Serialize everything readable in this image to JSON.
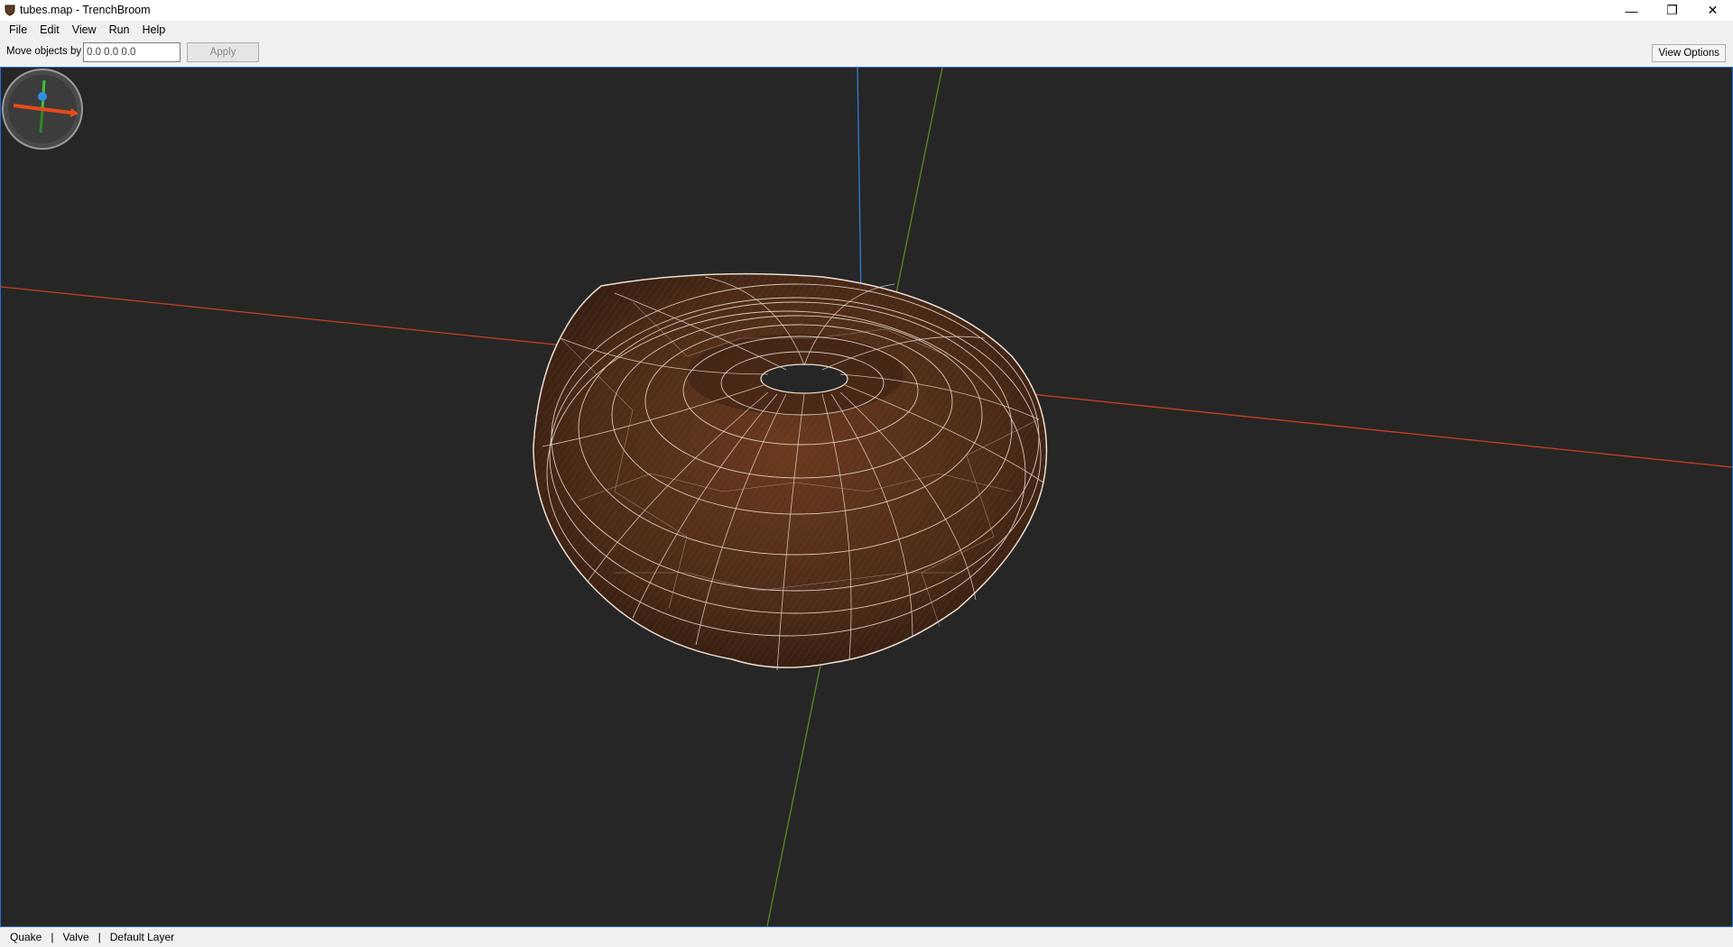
{
  "window": {
    "title": "tubes.map - TrenchBroom",
    "controls": {
      "minimize": "—",
      "restore": "❐",
      "close": "✕"
    }
  },
  "menu": {
    "items": [
      {
        "label": "File"
      },
      {
        "label": "Edit"
      },
      {
        "label": "View"
      },
      {
        "label": "Run"
      },
      {
        "label": "Help"
      }
    ]
  },
  "toolbar": {
    "move_label": "Move objects by",
    "move_value": "0.0 0.0 0.0",
    "apply_label": "Apply",
    "view_options_label": "View Options"
  },
  "viewport": {
    "background": "#262626",
    "border_color": "#2c6bd6",
    "axis_colors": {
      "x": "#c8401c",
      "y": "#5b8a1e",
      "z": "#2f7fd0"
    },
    "object": "torus brush wireframe",
    "object_fill": "#4a2a17",
    "wire_color": "#e8d8cc"
  },
  "status": {
    "items": [
      "Quake",
      "Valve",
      "Default Layer"
    ],
    "separator": "|"
  }
}
